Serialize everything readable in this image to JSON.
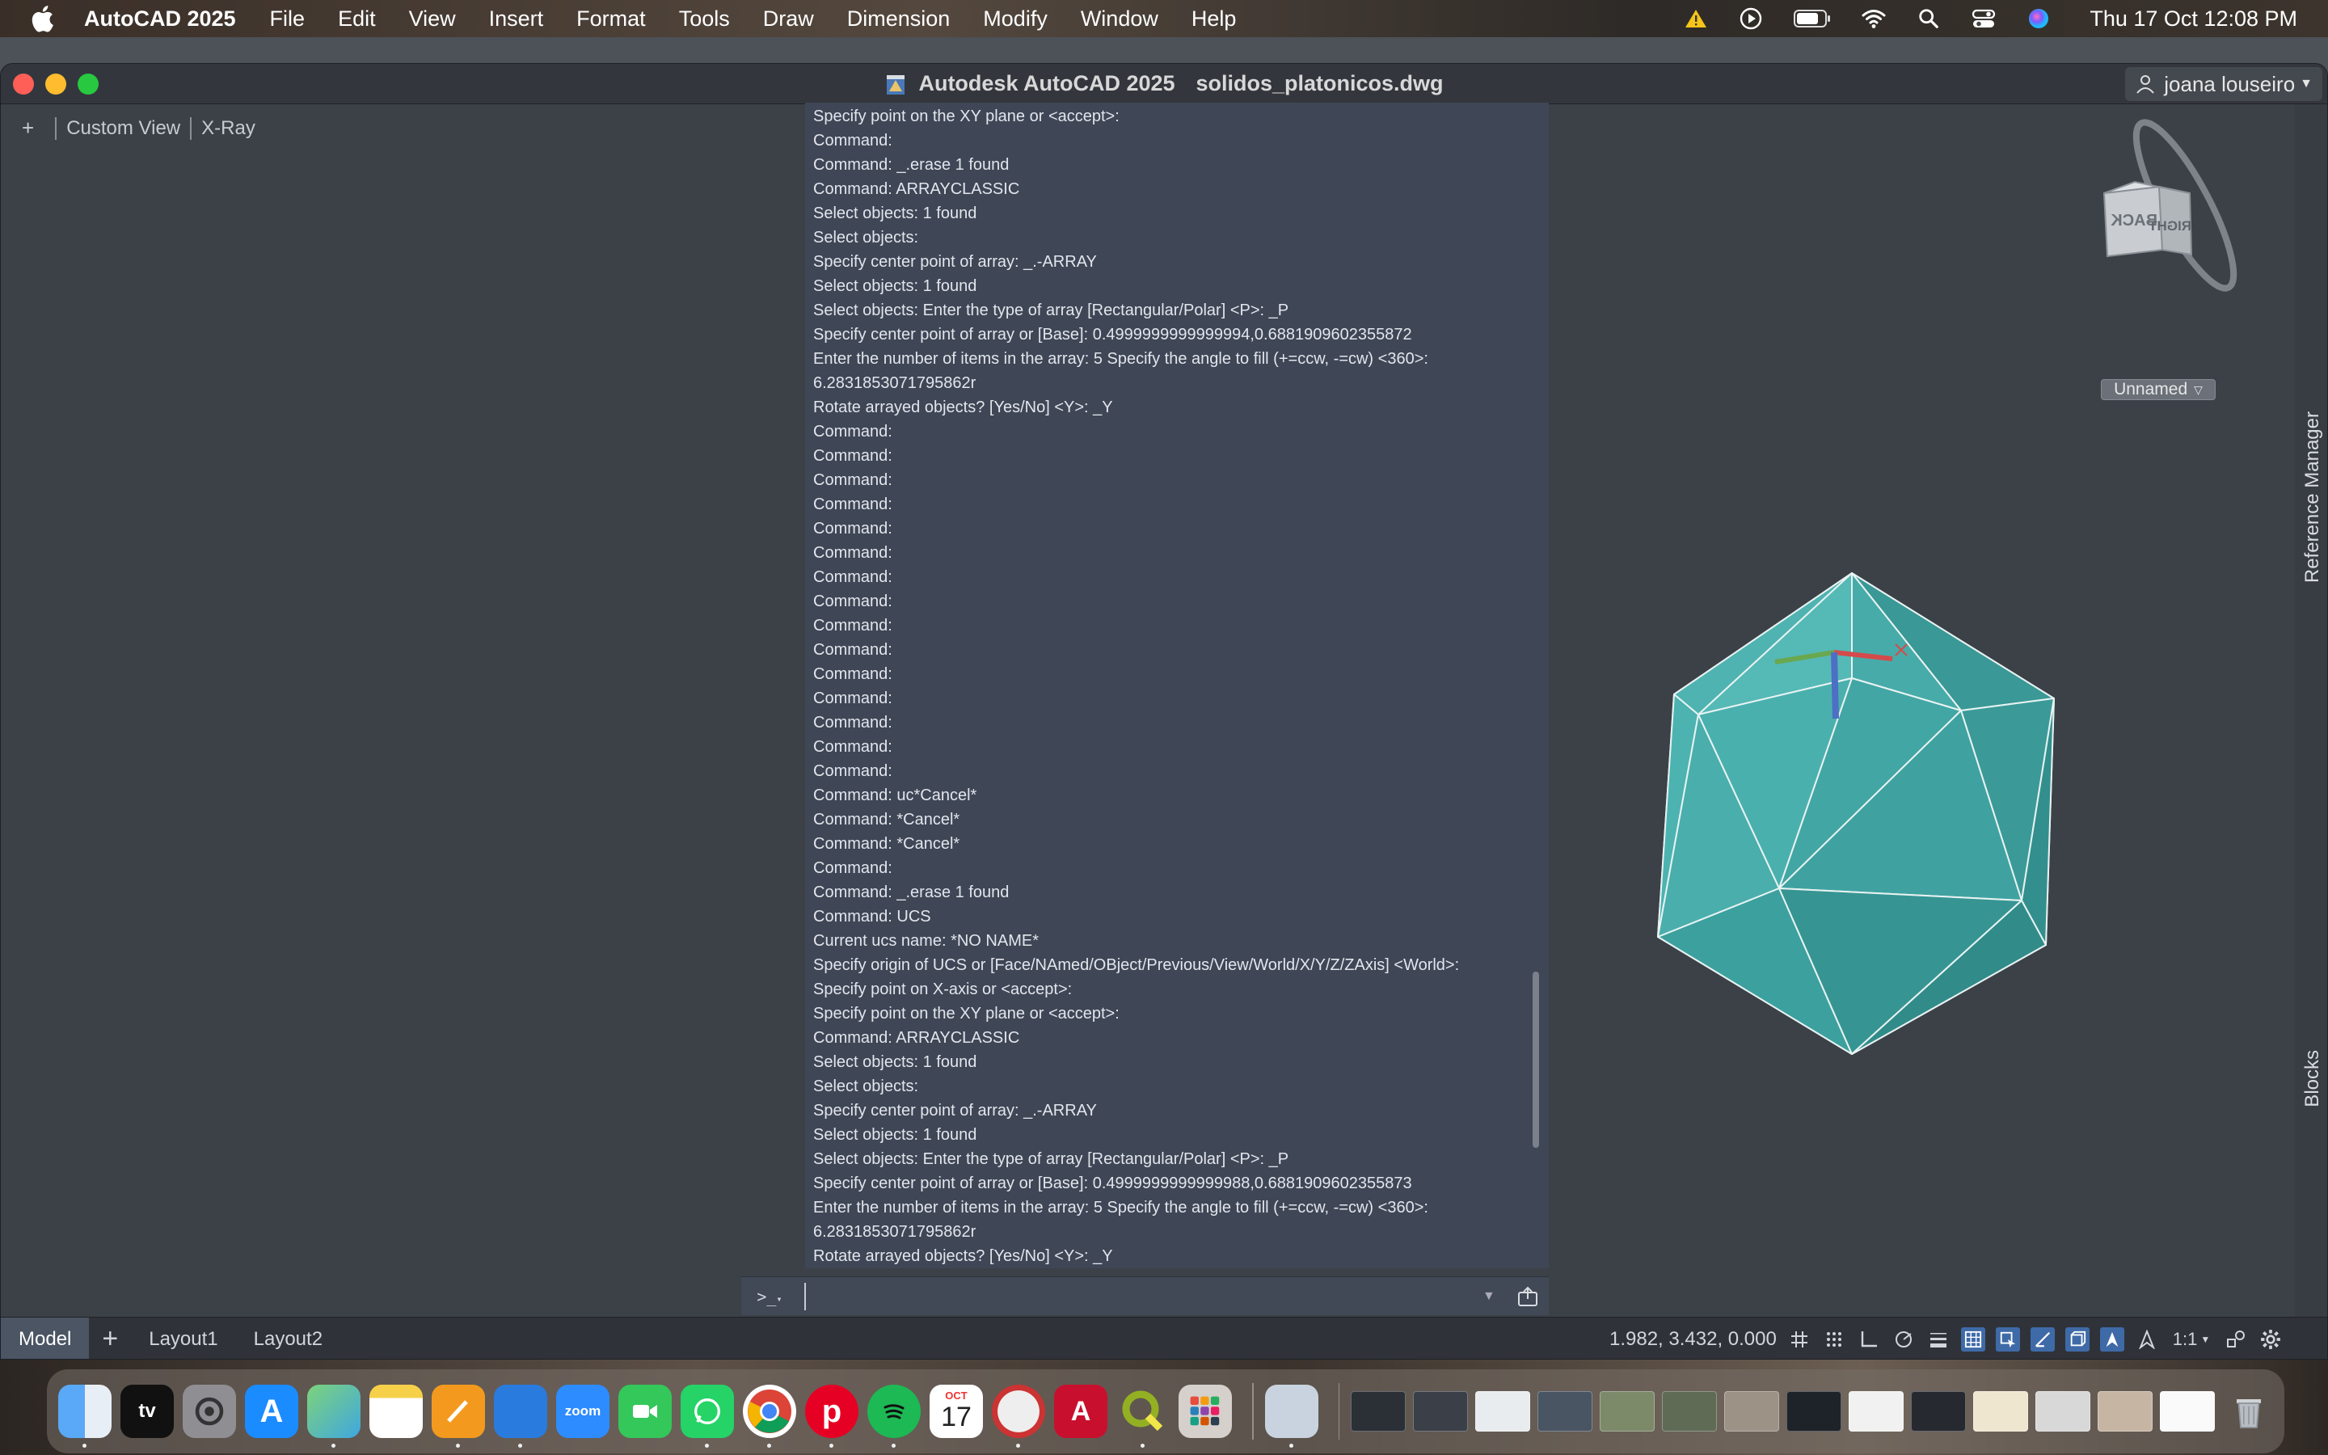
{
  "menubar": {
    "app_name": "AutoCAD 2025",
    "menus": [
      "File",
      "Edit",
      "View",
      "Insert",
      "Format",
      "Tools",
      "Draw",
      "Dimension",
      "Modify",
      "Window",
      "Help"
    ],
    "clock": "Thu 17 Oct  12:08 PM",
    "status_icons": [
      "warning-icon",
      "play-icon",
      "battery-icon",
      "wifi-icon",
      "search-icon",
      "control-center-icon",
      "siri-icon"
    ]
  },
  "window": {
    "app_title": "Autodesk AutoCAD 2025",
    "file_name": "solidos_platonicos.dwg",
    "user": "joana louseiro"
  },
  "viewport": {
    "plus": "+",
    "view_name": "Custom View",
    "visual_style": "X-Ray",
    "ucs_dropdown": "Unnamed",
    "viewcube_faces": [
      "BACK",
      "RIGHT"
    ],
    "collapse": "«"
  },
  "side_tabs": {
    "reference_manager": "Reference Manager",
    "blocks": "Blocks"
  },
  "command_history": [
    {
      "text": "Specify point on the XY plane or <accept>:"
    },
    {
      "text": "Command:"
    },
    {
      "text": "Command: _.erase 1 found"
    },
    {
      "text": "Command: ARRAYCLASSIC"
    },
    {
      "text": "Select objects: 1 found"
    },
    {
      "text": "Select objects:"
    },
    {
      "text": "Specify center point of array: _.-ARRAY"
    },
    {
      "text": "Select objects:   1 found"
    },
    {
      "text": "Select objects: Enter the type of array [Rectangular/Polar] <P>: _P"
    },
    {
      "text": "Specify center point of array or [Base]: 0.4999999999999994,0.6881909602355872"
    },
    {
      "text": "Enter the number of items in the array: 5 Specify the angle to fill (+=ccw, -=cw) <360>:",
      "wrap": "6.2831853071795862r"
    },
    {
      "text": "Rotate arrayed objects? [Yes/No] <Y>: _Y"
    },
    {
      "text": "Command:"
    },
    {
      "text": "Command:"
    },
    {
      "text": "Command:"
    },
    {
      "text": "Command:"
    },
    {
      "text": "Command:"
    },
    {
      "text": "Command:"
    },
    {
      "text": "Command:"
    },
    {
      "text": "Command:"
    },
    {
      "text": "Command:"
    },
    {
      "text": "Command:"
    },
    {
      "text": "Command:"
    },
    {
      "text": "Command:"
    },
    {
      "text": "Command:"
    },
    {
      "text": "Command:"
    },
    {
      "text": "Command:"
    },
    {
      "text": "Command: uc*Cancel*"
    },
    {
      "text": "Command: *Cancel*"
    },
    {
      "text": "Command: *Cancel*"
    },
    {
      "text": "Command:"
    },
    {
      "text": "Command: _.erase 1 found"
    },
    {
      "text": "Command: UCS"
    },
    {
      "text": "Current ucs name:  *NO NAME*"
    },
    {
      "text": "Specify origin of UCS or [Face/NAmed/OBject/Previous/View/World/X/Y/Z/ZAxis] <World>:"
    },
    {
      "text": "Specify point on X-axis or <accept>:"
    },
    {
      "text": "Specify point on the XY plane or <accept>:"
    },
    {
      "text": "Command: ARRAYCLASSIC"
    },
    {
      "text": "Select objects: 1 found"
    },
    {
      "text": "Select objects:"
    },
    {
      "text": "Specify center point of array: _.-ARRAY"
    },
    {
      "text": "Select objects:   1 found"
    },
    {
      "text": "Select objects: Enter the type of array [Rectangular/Polar] <P>: _P"
    },
    {
      "text": "Specify center point of array or [Base]: 0.4999999999999988,0.6881909602355873"
    },
    {
      "text": "Enter the number of items in the array: 5 Specify the angle to fill (+=ccw, -=cw) <360>:",
      "wrap": "6.2831853071795862r"
    },
    {
      "text": "Rotate arrayed objects? [Yes/No] <Y>: _Y"
    }
  ],
  "command_line": {
    "prompt": ">_",
    "input_value": ""
  },
  "statusbar": {
    "tabs": [
      "Model",
      "Layout1",
      "Layout2"
    ],
    "add_tab": "+",
    "coordinates": "1.982, 3.432, 0.000",
    "scale": "1:1"
  },
  "colors": {
    "solid_fill": "#40a5a3",
    "solid_edge": "#e8f3f2",
    "command_bg": "#3f4656",
    "active_tab": "#4b5564"
  },
  "dock": {
    "calendar_month": "OCT",
    "calendar_day": "17",
    "zoom_label": "zoom",
    "autocad_label": "A",
    "apps": [
      "finder",
      "apple-tv",
      "system-settings",
      "app-store",
      "maps",
      "notes",
      "pages",
      "keynote",
      "zoom",
      "facetime",
      "whatsapp",
      "chrome",
      "pinterest",
      "spotify",
      "calendar",
      "figure",
      "autocad",
      "qgis",
      "launchpad",
      "preview"
    ]
  }
}
